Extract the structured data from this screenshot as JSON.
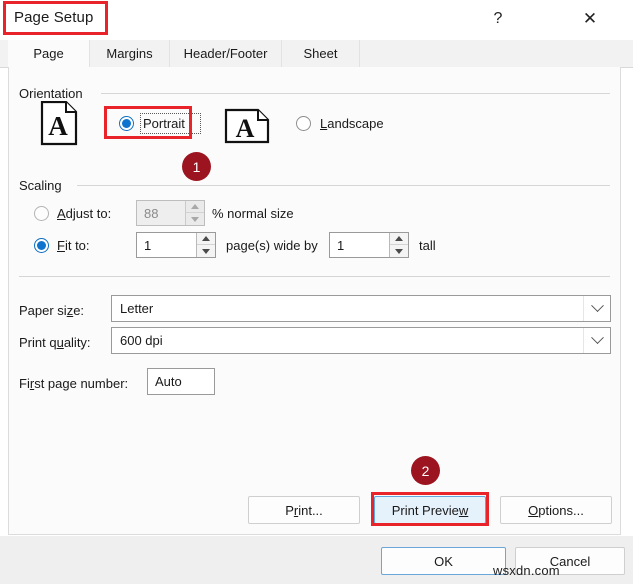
{
  "window": {
    "title": "Page Setup",
    "help_icon": "?",
    "close_icon": "✕"
  },
  "tabs": [
    {
      "label": "Page",
      "active": true
    },
    {
      "label": "Margins",
      "active": false
    },
    {
      "label": "Header/Footer",
      "active": false
    },
    {
      "label": "Sheet",
      "active": false
    }
  ],
  "orientation": {
    "group_label": "Orientation",
    "portrait": {
      "label": "Portrait",
      "selected": true,
      "icon": "portrait-page-icon"
    },
    "landscape": {
      "label": "Landscape",
      "selected": false,
      "icon": "landscape-page-icon"
    }
  },
  "scaling": {
    "group_label": "Scaling",
    "adjust_to": {
      "label": "Adjust to:",
      "value": "88",
      "suffix": "% normal size",
      "selected": false,
      "disabled": true
    },
    "fit_to": {
      "label": "Fit to:",
      "width_value": "1",
      "middle_text": "page(s) wide by",
      "height_value": "1",
      "suffix": "tall",
      "selected": true
    }
  },
  "fields": {
    "paper_size": {
      "label": "Paper size:",
      "value": "Letter"
    },
    "print_quality": {
      "label": "Print quality:",
      "value": "600 dpi"
    },
    "first_page_number": {
      "label": "First page number:",
      "value": "Auto"
    }
  },
  "action_buttons": {
    "print": "Print...",
    "print_preview": "Print Preview",
    "options": "Options..."
  },
  "footer_buttons": {
    "ok": "OK",
    "cancel": "Cancel"
  },
  "annotations": {
    "badge_one": "1",
    "badge_two": "2",
    "highlight_color": "#e8232a",
    "badge_color": "#9c1420"
  },
  "watermark": "wsxdn.com"
}
